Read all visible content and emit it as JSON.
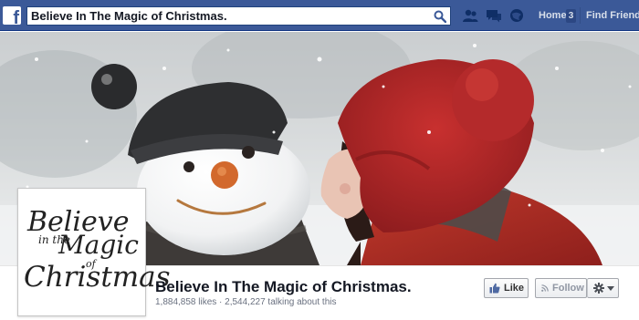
{
  "topbar": {
    "logo": "f",
    "search_value": "Believe In The Magic of Christmas.",
    "icons": [
      "search-icon",
      "friend-requests-icon",
      "messages-icon",
      "notifications-icon"
    ],
    "home_label": "Home",
    "home_count": "3",
    "find_friends_label": "Find Friends",
    "brand_color": "#3b5998"
  },
  "cover": {
    "description_colors": [
      "#b9252a",
      "#f4f5f6",
      "#2b2b2b",
      "#d2692d"
    ]
  },
  "profile": {
    "avatar_lines": [
      "Believe",
      "in the",
      "Magic",
      "of",
      "Christmas"
    ],
    "page_name": "Believe In The Magic of Christmas.",
    "likes": "1,884,858 likes",
    "separator": "·",
    "talking": "2,544,227 talking about this",
    "stats_text": "1,884,858 likes · 2,544,227 talking about this"
  },
  "actions": {
    "like_label": "Like",
    "follow_label": "Follow",
    "icons": [
      "thumbs-up-icon",
      "rss-icon",
      "gear-icon",
      "caret-down-icon"
    ]
  }
}
